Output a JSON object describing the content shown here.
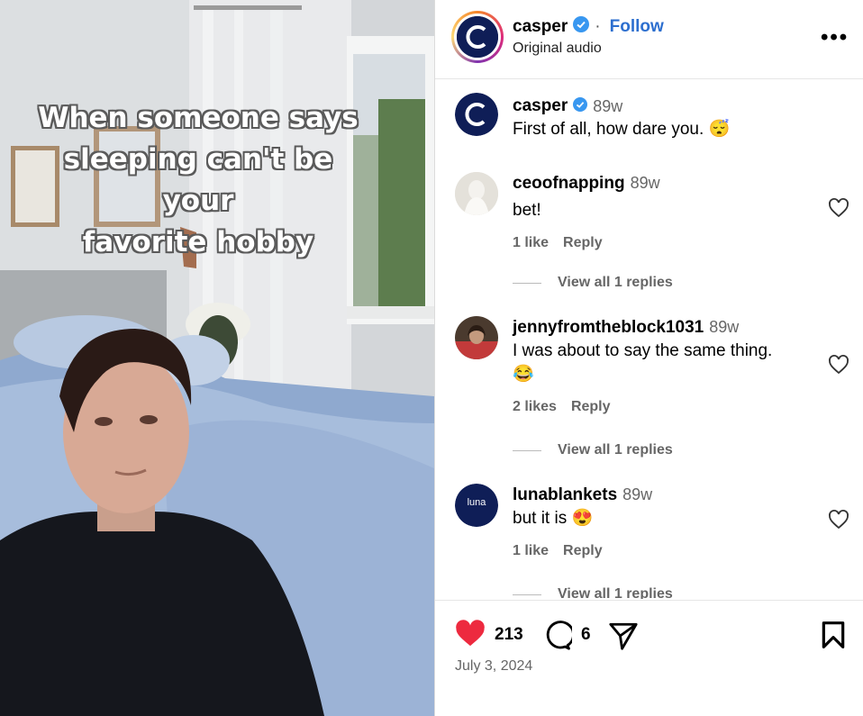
{
  "media": {
    "caption_lines": [
      "When someone says",
      "sleeping can't be your",
      "favorite hobby"
    ]
  },
  "header": {
    "username": "casper",
    "follow_label": "Follow",
    "separator": "·",
    "subtitle": "Original audio",
    "more_label": "•••",
    "logo_letter": "C"
  },
  "caption_comment": {
    "username": "casper",
    "time": "89w",
    "text": "First of all, how dare you. 😴"
  },
  "comments": [
    {
      "username": "ceoofnapping",
      "time": "89w",
      "text": "bet!",
      "likes": "1 like",
      "reply": "Reply",
      "view_replies": "View all 1 replies"
    },
    {
      "username": "jennyfromtheblock1031",
      "time": "89w",
      "text": "I was about to say the same thing.",
      "text2": "😂",
      "likes": "2 likes",
      "reply": "Reply",
      "view_replies": "View all 1 replies"
    },
    {
      "username": "lunablankets",
      "time": "89w",
      "text": "but it is 😍",
      "likes": "1 like",
      "reply": "Reply",
      "view_replies": "View all 1 replies",
      "avatar_text": "luna"
    }
  ],
  "actions": {
    "like_count": "213",
    "comment_count": "6",
    "date": "July 3, 2024"
  },
  "colors": {
    "like_red": "#ed2a3f",
    "follow_blue": "#2d6fcf",
    "casper_navy": "#0f1e57",
    "verified_blue": "#3897f0"
  }
}
